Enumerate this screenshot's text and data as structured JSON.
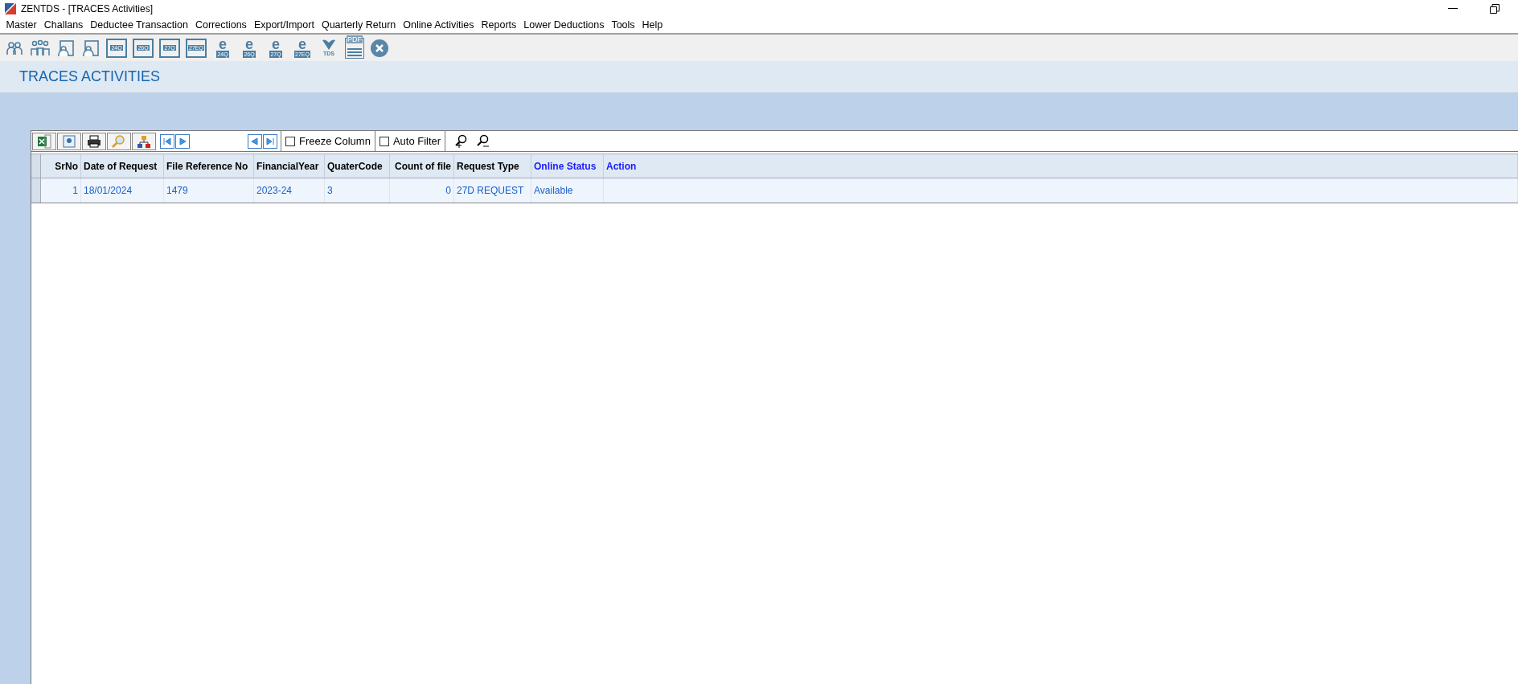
{
  "window": {
    "title": "ZENTDS - [TRACES Activities]"
  },
  "menu": [
    "Master",
    "Challans",
    "Deductee Transaction",
    "Corrections",
    "Export/Import",
    "Quarterly Return",
    "Online Activities",
    "Reports",
    "Lower Deductions",
    "Tools",
    "Help"
  ],
  "toolbar": [
    {
      "kind": "people"
    },
    {
      "kind": "group"
    },
    {
      "kind": "person-form"
    },
    {
      "kind": "person-form"
    },
    {
      "kind": "form",
      "label": "24Q"
    },
    {
      "kind": "form",
      "label": "26Q"
    },
    {
      "kind": "form",
      "label": "27Q"
    },
    {
      "kind": "form",
      "label": "27EQ"
    },
    {
      "kind": "efile",
      "letter": "e",
      "label": "24Q"
    },
    {
      "kind": "efile",
      "letter": "e",
      "label": "26Q"
    },
    {
      "kind": "efile",
      "letter": "e",
      "label": "27Q"
    },
    {
      "kind": "efile",
      "letter": "e",
      "label": "27EQ"
    },
    {
      "kind": "logo",
      "label": "TDS"
    },
    {
      "kind": "pdf",
      "label": "PDF"
    },
    {
      "kind": "close"
    }
  ],
  "page_title": "TRACES ACTIVITIES",
  "grid_toolbar": {
    "freeze_column": {
      "label": "Freeze Column",
      "checked": false
    },
    "auto_filter": {
      "label": "Auto Filter",
      "checked": false
    }
  },
  "table": {
    "columns": [
      {
        "label": "SrNo",
        "link": false
      },
      {
        "label": "Date of Request",
        "link": false
      },
      {
        "label": "File Reference No",
        "link": false
      },
      {
        "label": "FinancialYear",
        "link": false
      },
      {
        "label": "QuaterCode",
        "link": false
      },
      {
        "label": "Count of file",
        "link": false
      },
      {
        "label": "Request Type",
        "link": false
      },
      {
        "label": "Online Status",
        "link": true
      },
      {
        "label": "Action",
        "link": true
      }
    ],
    "rows": [
      {
        "cells": [
          "1",
          "18/01/2024",
          "1479",
          "2023-24",
          "3",
          "0",
          "27D REQUEST",
          "Available",
          null
        ]
      }
    ]
  }
}
